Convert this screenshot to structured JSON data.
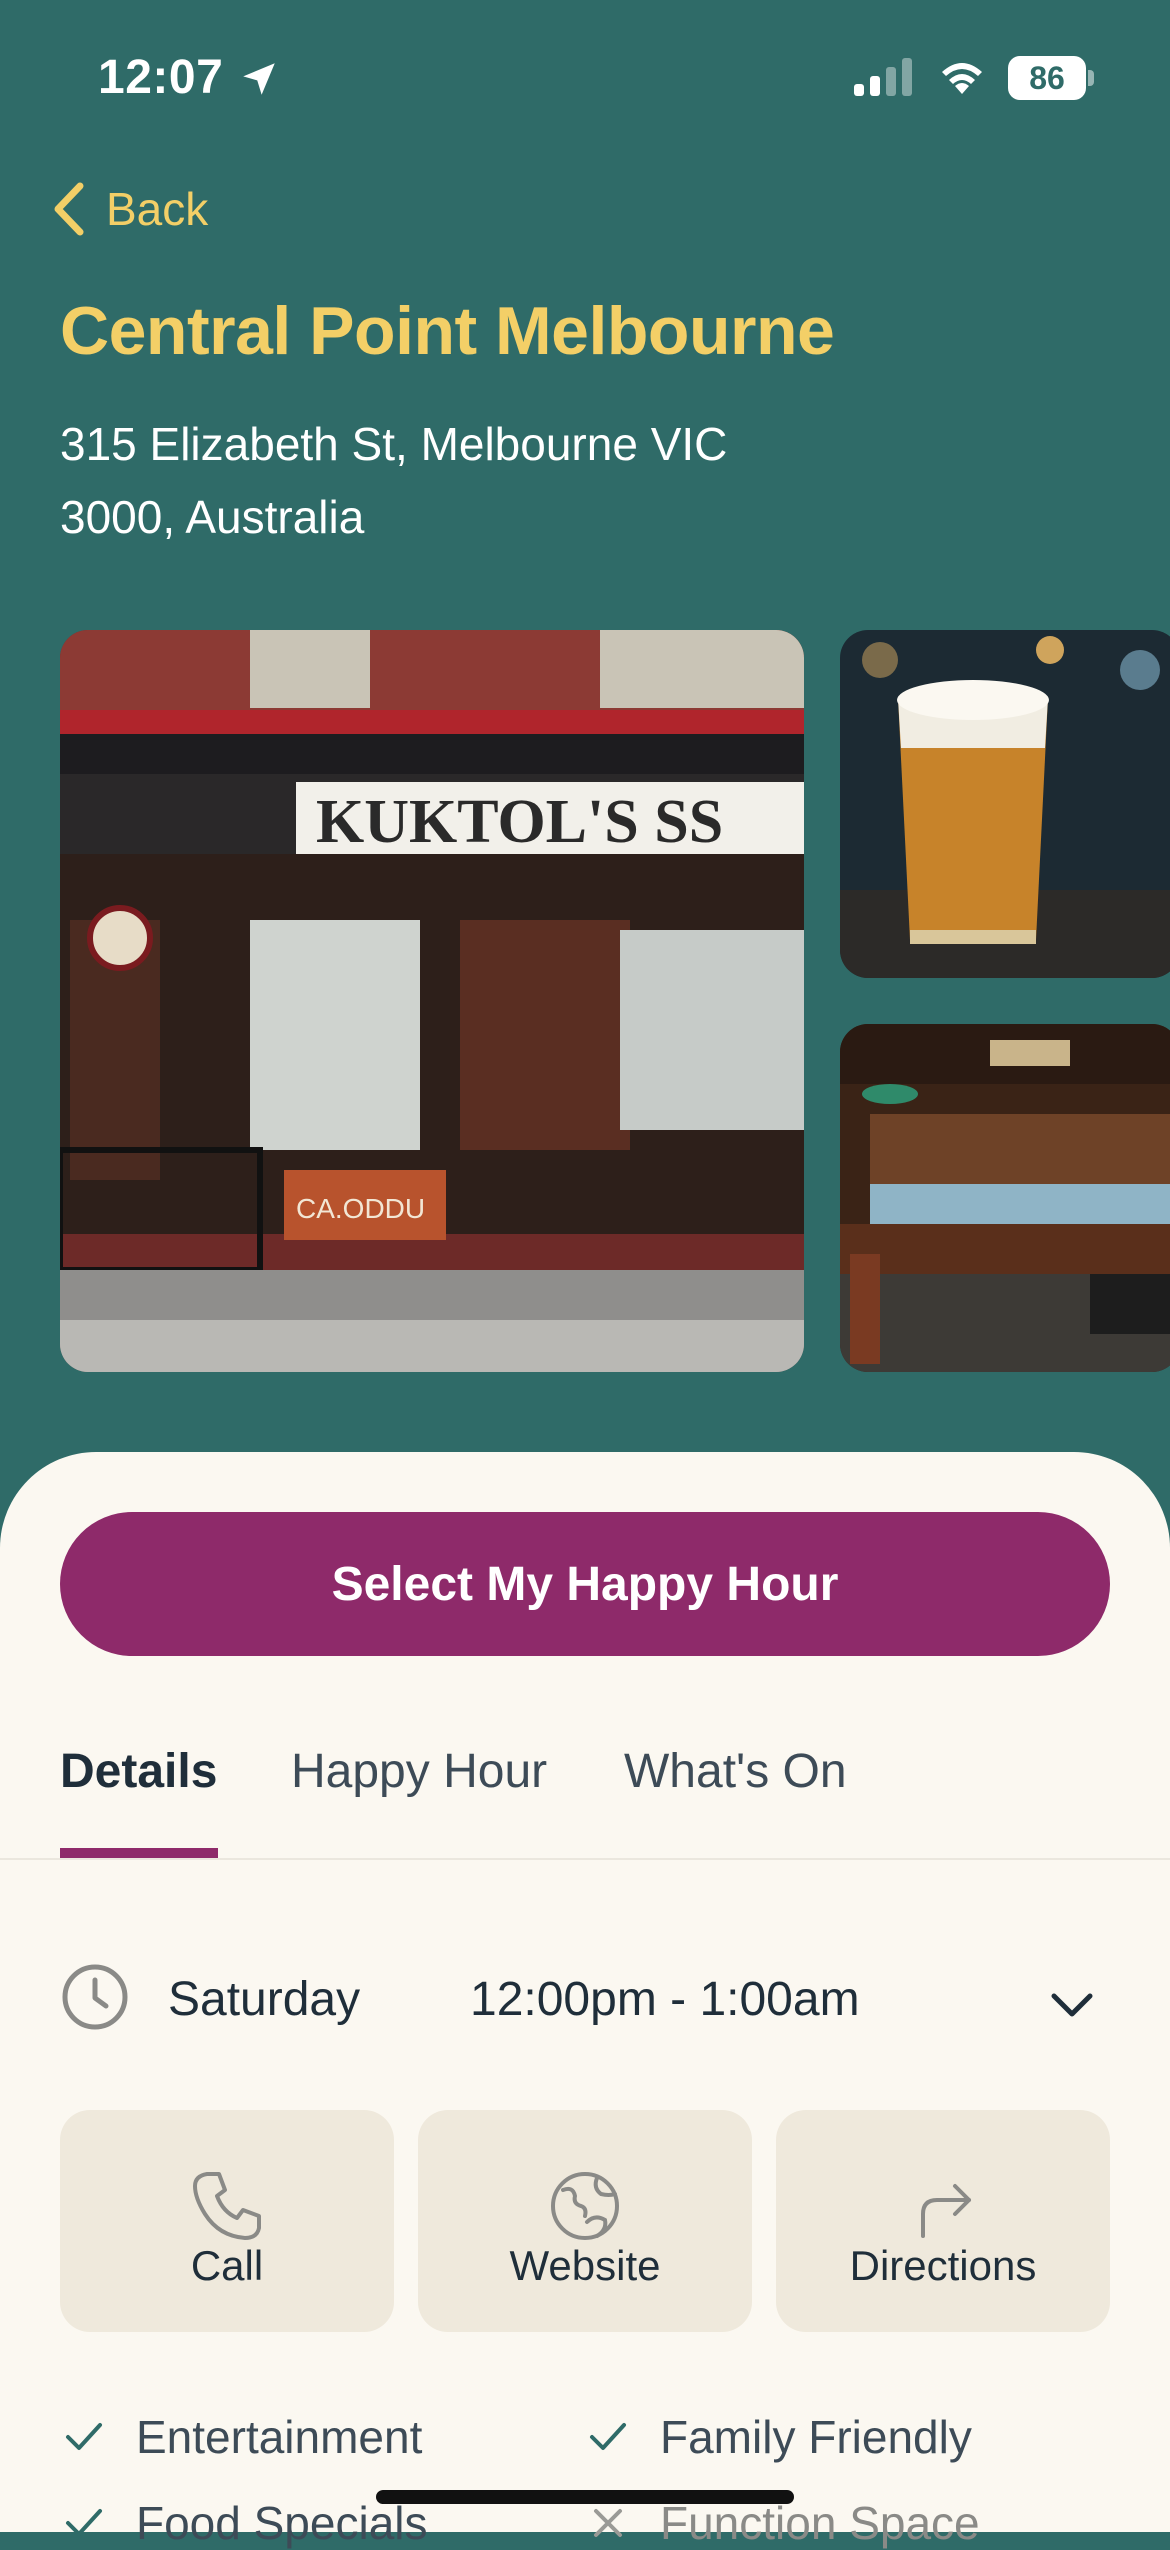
{
  "status_bar": {
    "time": "12:07",
    "battery": "86"
  },
  "nav": {
    "back_label": "Back"
  },
  "venue": {
    "name": "Central Point Melbourne",
    "address": "315 Elizabeth St, Melbourne VIC 3000, Australia"
  },
  "photos": {
    "storefront_sign": "KUKTOL'S SS",
    "board_text": "CA.ODDU"
  },
  "cta": {
    "label": "Select My Happy Hour"
  },
  "tabs": [
    {
      "label": "Details",
      "active": true
    },
    {
      "label": "Happy Hour",
      "active": false
    },
    {
      "label": "What's On",
      "active": false
    }
  ],
  "hours": {
    "day": "Saturday",
    "time": "12:00pm - 1:00am"
  },
  "actions": [
    {
      "label": "Call",
      "icon": "phone-icon"
    },
    {
      "label": "Website",
      "icon": "globe-icon"
    },
    {
      "label": "Directions",
      "icon": "directions-icon"
    }
  ],
  "features": [
    {
      "label": "Entertainment",
      "available": true
    },
    {
      "label": "Family Friendly",
      "available": true
    },
    {
      "label": "Food Specials",
      "available": true
    },
    {
      "label": "Function Space",
      "available": false
    }
  ],
  "colors": {
    "header_bg": "#2f6b68",
    "title": "#f3cf67",
    "accent": "#8e2a6a",
    "sheet_bg": "#fbf8f1",
    "card_bg": "#efe9dc"
  }
}
